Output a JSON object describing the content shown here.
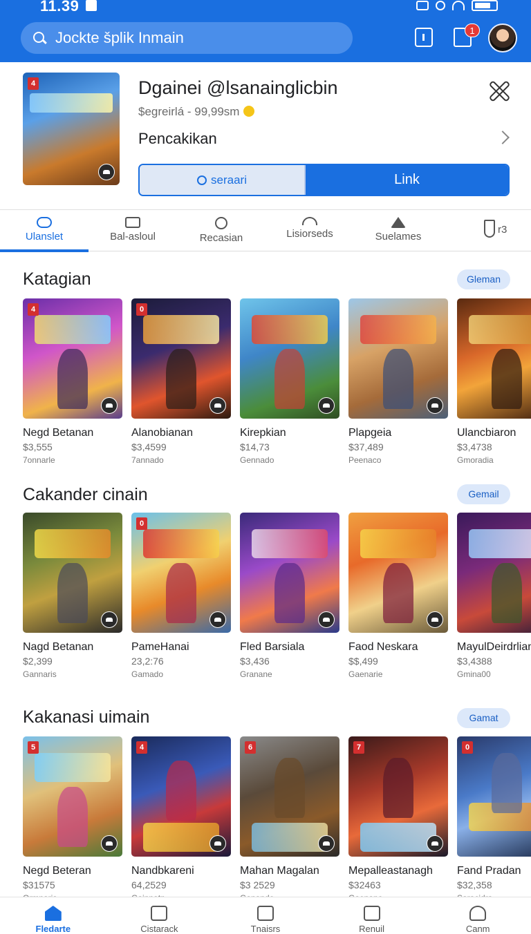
{
  "status": {
    "time": "11.39"
  },
  "search": {
    "placeholder": "Jockte šplik Inmain"
  },
  "header": {
    "notification_count": "1"
  },
  "featured": {
    "badge": "4",
    "title": "Dgainei @lsanainglicbin",
    "subtitle": "$egreirlá - 99,99sm",
    "section": "Pencakikan",
    "search_label": "seraari",
    "link_label": "Link"
  },
  "tabs": [
    {
      "label": "Ulanslet"
    },
    {
      "label": "Bal-asloul"
    },
    {
      "label": "Recasian"
    },
    {
      "label": "Lisiorseds"
    },
    {
      "label": "Suelames"
    },
    {
      "label": "r3"
    }
  ],
  "sections": [
    {
      "title": "Katagian",
      "more": "Gleman",
      "items": [
        {
          "badge": "4",
          "name": "Negd Betanan",
          "price": "$3,555",
          "genre": "7onnarle"
        },
        {
          "badge": "0",
          "name": "Alanobianan",
          "price": "$3,4599",
          "genre": "7annado"
        },
        {
          "badge": "",
          "name": "Kirepkian",
          "price": "$14,73",
          "genre": "Gennado"
        },
        {
          "badge": "",
          "name": "Plapgeia",
          "price": "$37,489",
          "genre": "Peenaco"
        },
        {
          "badge": "",
          "name": "Ulancbiaron",
          "price": "$3,4738",
          "genre": "Gmoradia"
        }
      ]
    },
    {
      "title": "Cakander cinain",
      "more": "Gemail",
      "items": [
        {
          "badge": "",
          "name": "Nagd Betanan",
          "price": "$2,399",
          "genre": "Gannaris"
        },
        {
          "badge": "0",
          "name": "PameHanai",
          "price": "23,2:76",
          "genre": "Gamado"
        },
        {
          "badge": "",
          "name": "Fled Barsiala",
          "price": "$3,436",
          "genre": "Granane"
        },
        {
          "badge": "",
          "name": "Faod Neskara",
          "price": "$$,499",
          "genre": "Gaenarie"
        },
        {
          "badge": "",
          "name": "MayulDeirdrlianl",
          "price": "$3,4388",
          "genre": "Gmina00"
        }
      ]
    },
    {
      "title": "Kakanasi uimain",
      "more": "Gamat",
      "items": [
        {
          "badge": "5",
          "name": "Negd Beteran",
          "price": "$31575",
          "genre": "Ormnaris"
        },
        {
          "badge": "4",
          "name": "Nandbkareni",
          "price": "64,2529",
          "genre": "Gainnatn"
        },
        {
          "badge": "6",
          "name": "Mahan Magalan",
          "price": "$3 2529",
          "genre": "Ganando"
        },
        {
          "badge": "7",
          "name": "Mepalleastanagh",
          "price": "$32463",
          "genre": "Gaenano"
        },
        {
          "badge": "0",
          "name": "Fand Pradan",
          "price": "$32,358",
          "genre": "Saracidra"
        }
      ]
    }
  ],
  "bottom_nav": [
    {
      "label": "Fledarte"
    },
    {
      "label": "Cistarack"
    },
    {
      "label": "Tnaisrs"
    },
    {
      "label": "Renuil"
    },
    {
      "label": "Canm"
    }
  ],
  "colors": {
    "accent": "#1a6fe0",
    "more_pill_bg": "#dce8fa",
    "badge_red": "#d32f2f"
  }
}
